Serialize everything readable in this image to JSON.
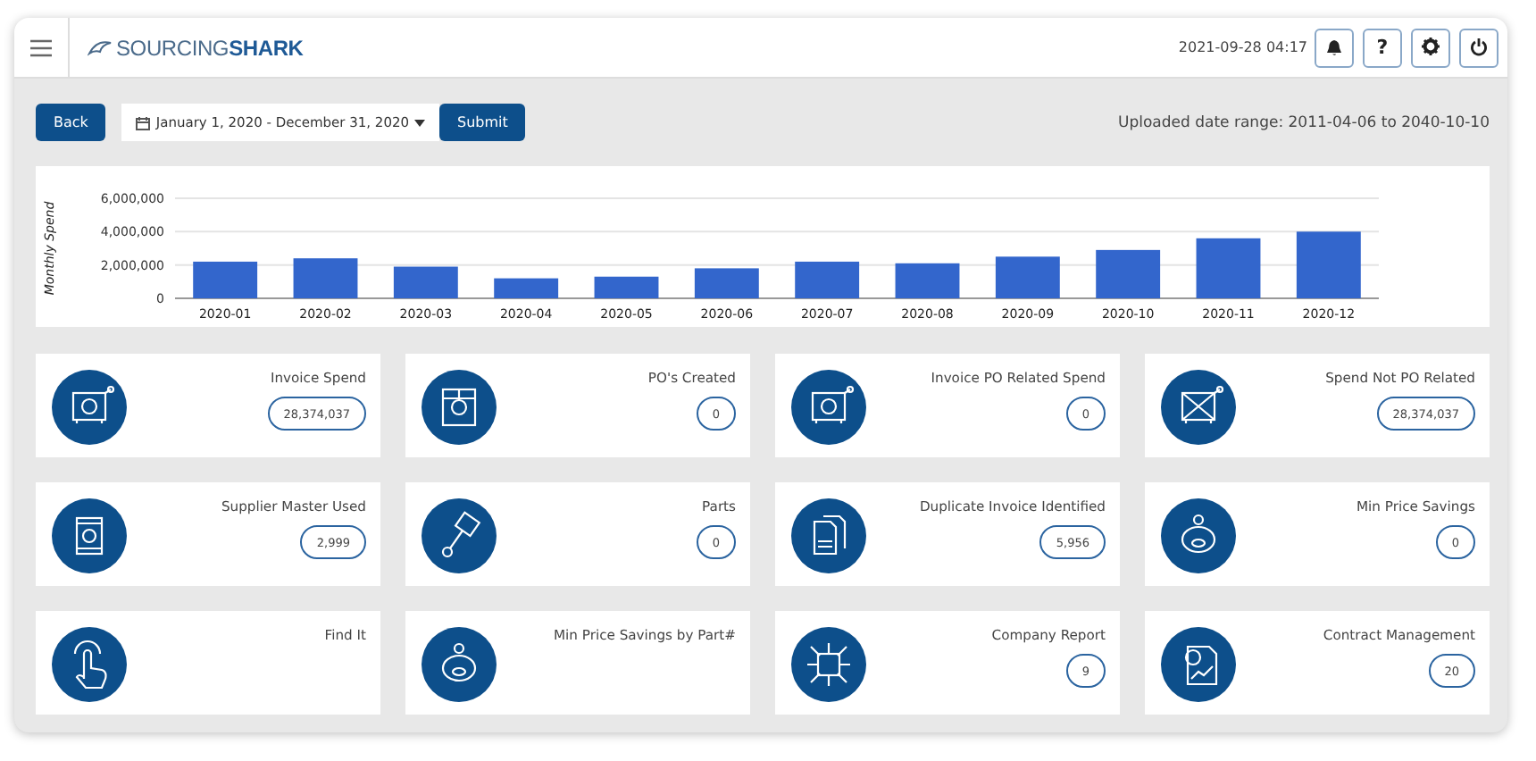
{
  "header": {
    "logo": "SOURCING**SHARK**",
    "datetime": "2021-09-28 04:17",
    "buttons": [
      {
        "kind": "bell"
      },
      {
        "kind": "text",
        "label": "?"
      },
      {
        "kind": "gear"
      },
      {
        "kind": "power"
      }
    ]
  },
  "toolbar": {
    "back": "Back",
    "date_range": "January 1, 2020 - December 31, 2020",
    "submit": "Submit",
    "uploaded_range": "Uploaded date range: 2011-04-06 to 2040-10-10"
  },
  "chart_data": {
    "type": "bar",
    "ylabel": "Monthly Spend",
    "categories": [
      "2020-01",
      "2020-02",
      "2020-03",
      "2020-04",
      "2020-05",
      "2020-06",
      "2020-07",
      "2020-08",
      "2020-09",
      "2020-10",
      "2020-11",
      "2020-12"
    ],
    "series": [
      {
        "color": "#3366cc",
        "values": [
          2200000,
          2400000,
          1900000,
          1200000,
          1300000,
          1800000,
          2200000,
          2100000,
          2500000,
          2900000,
          3600000,
          4000000
        ]
      }
    ],
    "ylim": [
      0,
      6000000
    ],
    "yticks": [
      {
        "value": 0,
        "label": "0"
      },
      {
        "value": 2000000,
        "label": "2,000,000"
      },
      {
        "value": 4000000,
        "label": "4,000,000"
      },
      {
        "value": 6000000,
        "label": "6,000,000"
      }
    ]
  },
  "tiles": [
    {
      "title": "Invoice Spend",
      "value": "28,374,037"
    },
    {
      "title": "PO's Created",
      "value": "0"
    },
    {
      "title": "Invoice PO Related Spend",
      "value": "0"
    },
    {
      "title": "Spend Not PO Related",
      "value": "28,374,037"
    },
    {
      "title": "Supplier Master Used",
      "value": "2,999"
    },
    {
      "title": "Parts",
      "value": "0"
    },
    {
      "title": "Duplicate Invoice Identified",
      "value": "5,956"
    },
    {
      "title": "Min Price Savings",
      "value": "0"
    },
    {
      "title": "Find It"
    },
    {
      "title": "Min Price Savings by Part#"
    },
    {
      "title": "Company Report",
      "value": "9"
    },
    {
      "title": "Contract Management",
      "value": "20"
    }
  ]
}
